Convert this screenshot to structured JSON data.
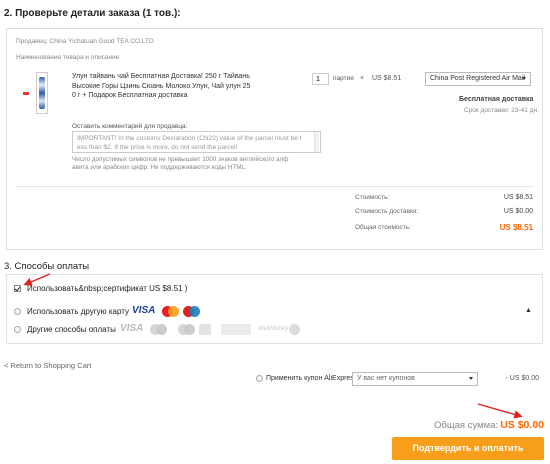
{
  "section2": {
    "title": "2. Проверьте детали заказа (1 тов.):",
    "seller_label": "Продавец: China Yichatuan Good TEA CO.LTD",
    "product_header": "Наименование товара и описание",
    "product_title_lines": [
      "Улун тайвань чай Бесплатная Доставка! 250 г Тайвань",
      "Высокие Горы Цзинь Сюань Молоко Улун, Чай улун 25",
      "0 г + Подарок Бесплатная доставка"
    ],
    "quantity_value": "1",
    "unit_label": "партия",
    "price_multiplier": "×",
    "unit_price": "US $8.51",
    "shipping_method": "China Post Registered Air Mail",
    "free_shipping": "Бесплатная доставка",
    "delivery_time": "Срок доставки: 23-41 дн.",
    "comment_label": "Оставить комментарий для продавца:",
    "comment_lines": [
      "IMPORTANT! In the customs Declaration (CN22) value of the parcel must be l",
      "ess than $2. If the price is more, do not send the parcel!"
    ],
    "comment_hint_lines": [
      "Число допустимых символов не превышает 1000 знаков английского алф",
      "авита или арабских цифр. Не поддерживаются коды HTML."
    ],
    "cost_label": "Стоимость:",
    "cost_value": "US $8.51",
    "shipping_cost_label": "Стоимость доставки:",
    "shipping_cost_value": "US $0.00",
    "total_label": "Общая стоимость:",
    "total_value": "US $8.51"
  },
  "section3": {
    "title": "3. Способы оплаты",
    "options": [
      {
        "label": "Использовать&nbsp;сертификат US $8.51 )",
        "checked": true
      },
      {
        "label": "Использовать другую карту"
      },
      {
        "label": "Другие способы оплаты"
      }
    ],
    "payment_brands": {
      "visa": "VISA",
      "alipay_like": "",
      "webmoney": "WebMoney"
    }
  },
  "footer": {
    "back_link": "< Return to Shopping Cart",
    "coupon_label": "Применить купон AliExpress:",
    "coupon_select": "У вас нет купонов",
    "coupon_amount": "- US $0.00",
    "grand_total_label": "Общая сумма:",
    "grand_total_value": "US $0.00",
    "confirm_button": "Подтвердить и оплатить"
  },
  "colors": {
    "accent_orange": "#f60",
    "button_orange": "#f79e1b",
    "annotation_red": "#e02020"
  }
}
